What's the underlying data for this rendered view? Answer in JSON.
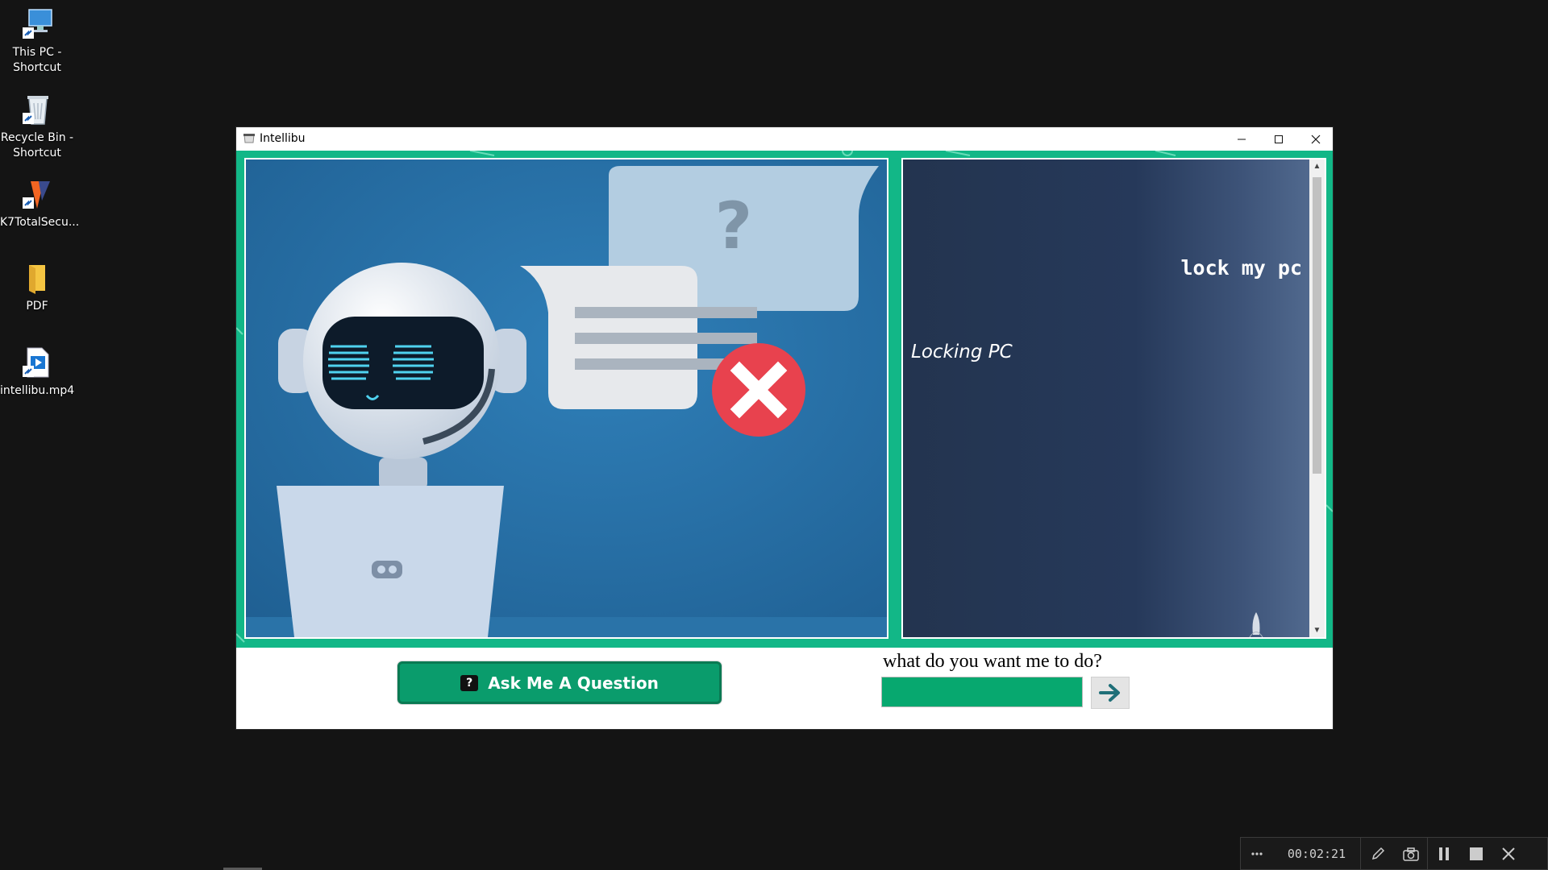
{
  "desktop": {
    "icons": [
      {
        "label": "This PC -\nShortcut",
        "icon": "this-pc-icon"
      },
      {
        "label": "Recycle Bin -\nShortcut",
        "icon": "recycle-bin-icon"
      },
      {
        "label": "K7TotalSecu...",
        "icon": "k7-security-icon"
      },
      {
        "label": "PDF",
        "icon": "folder-icon"
      },
      {
        "label": "intellibu.mp4",
        "icon": "video-file-icon"
      }
    ]
  },
  "window": {
    "title": "Intellibu",
    "controls": {
      "minimize": "minimize-icon",
      "maximize": "maximize-icon",
      "close": "close-icon"
    }
  },
  "chat": {
    "messages": [
      {
        "from": "user",
        "text": "lock my pc"
      },
      {
        "from": "bot",
        "text": "Locking PC"
      }
    ]
  },
  "controls": {
    "ask_button_label": "Ask Me A Question",
    "ask_button_icon": "?",
    "prompt_label": "what do you want me to do?",
    "input_value": "",
    "send_icon": "arrow-right-icon"
  },
  "illustration": {
    "speech_bubble_symbol": "?"
  },
  "recorder": {
    "timer": "00:02:21",
    "more_icon": "more-dots-icon"
  },
  "colors": {
    "desktop_bg": "#141414",
    "accent_green": "#12b787",
    "button_green": "#0a9c6c",
    "chat_bg": "#23344f",
    "robot_bg": "#2b6fa6"
  }
}
